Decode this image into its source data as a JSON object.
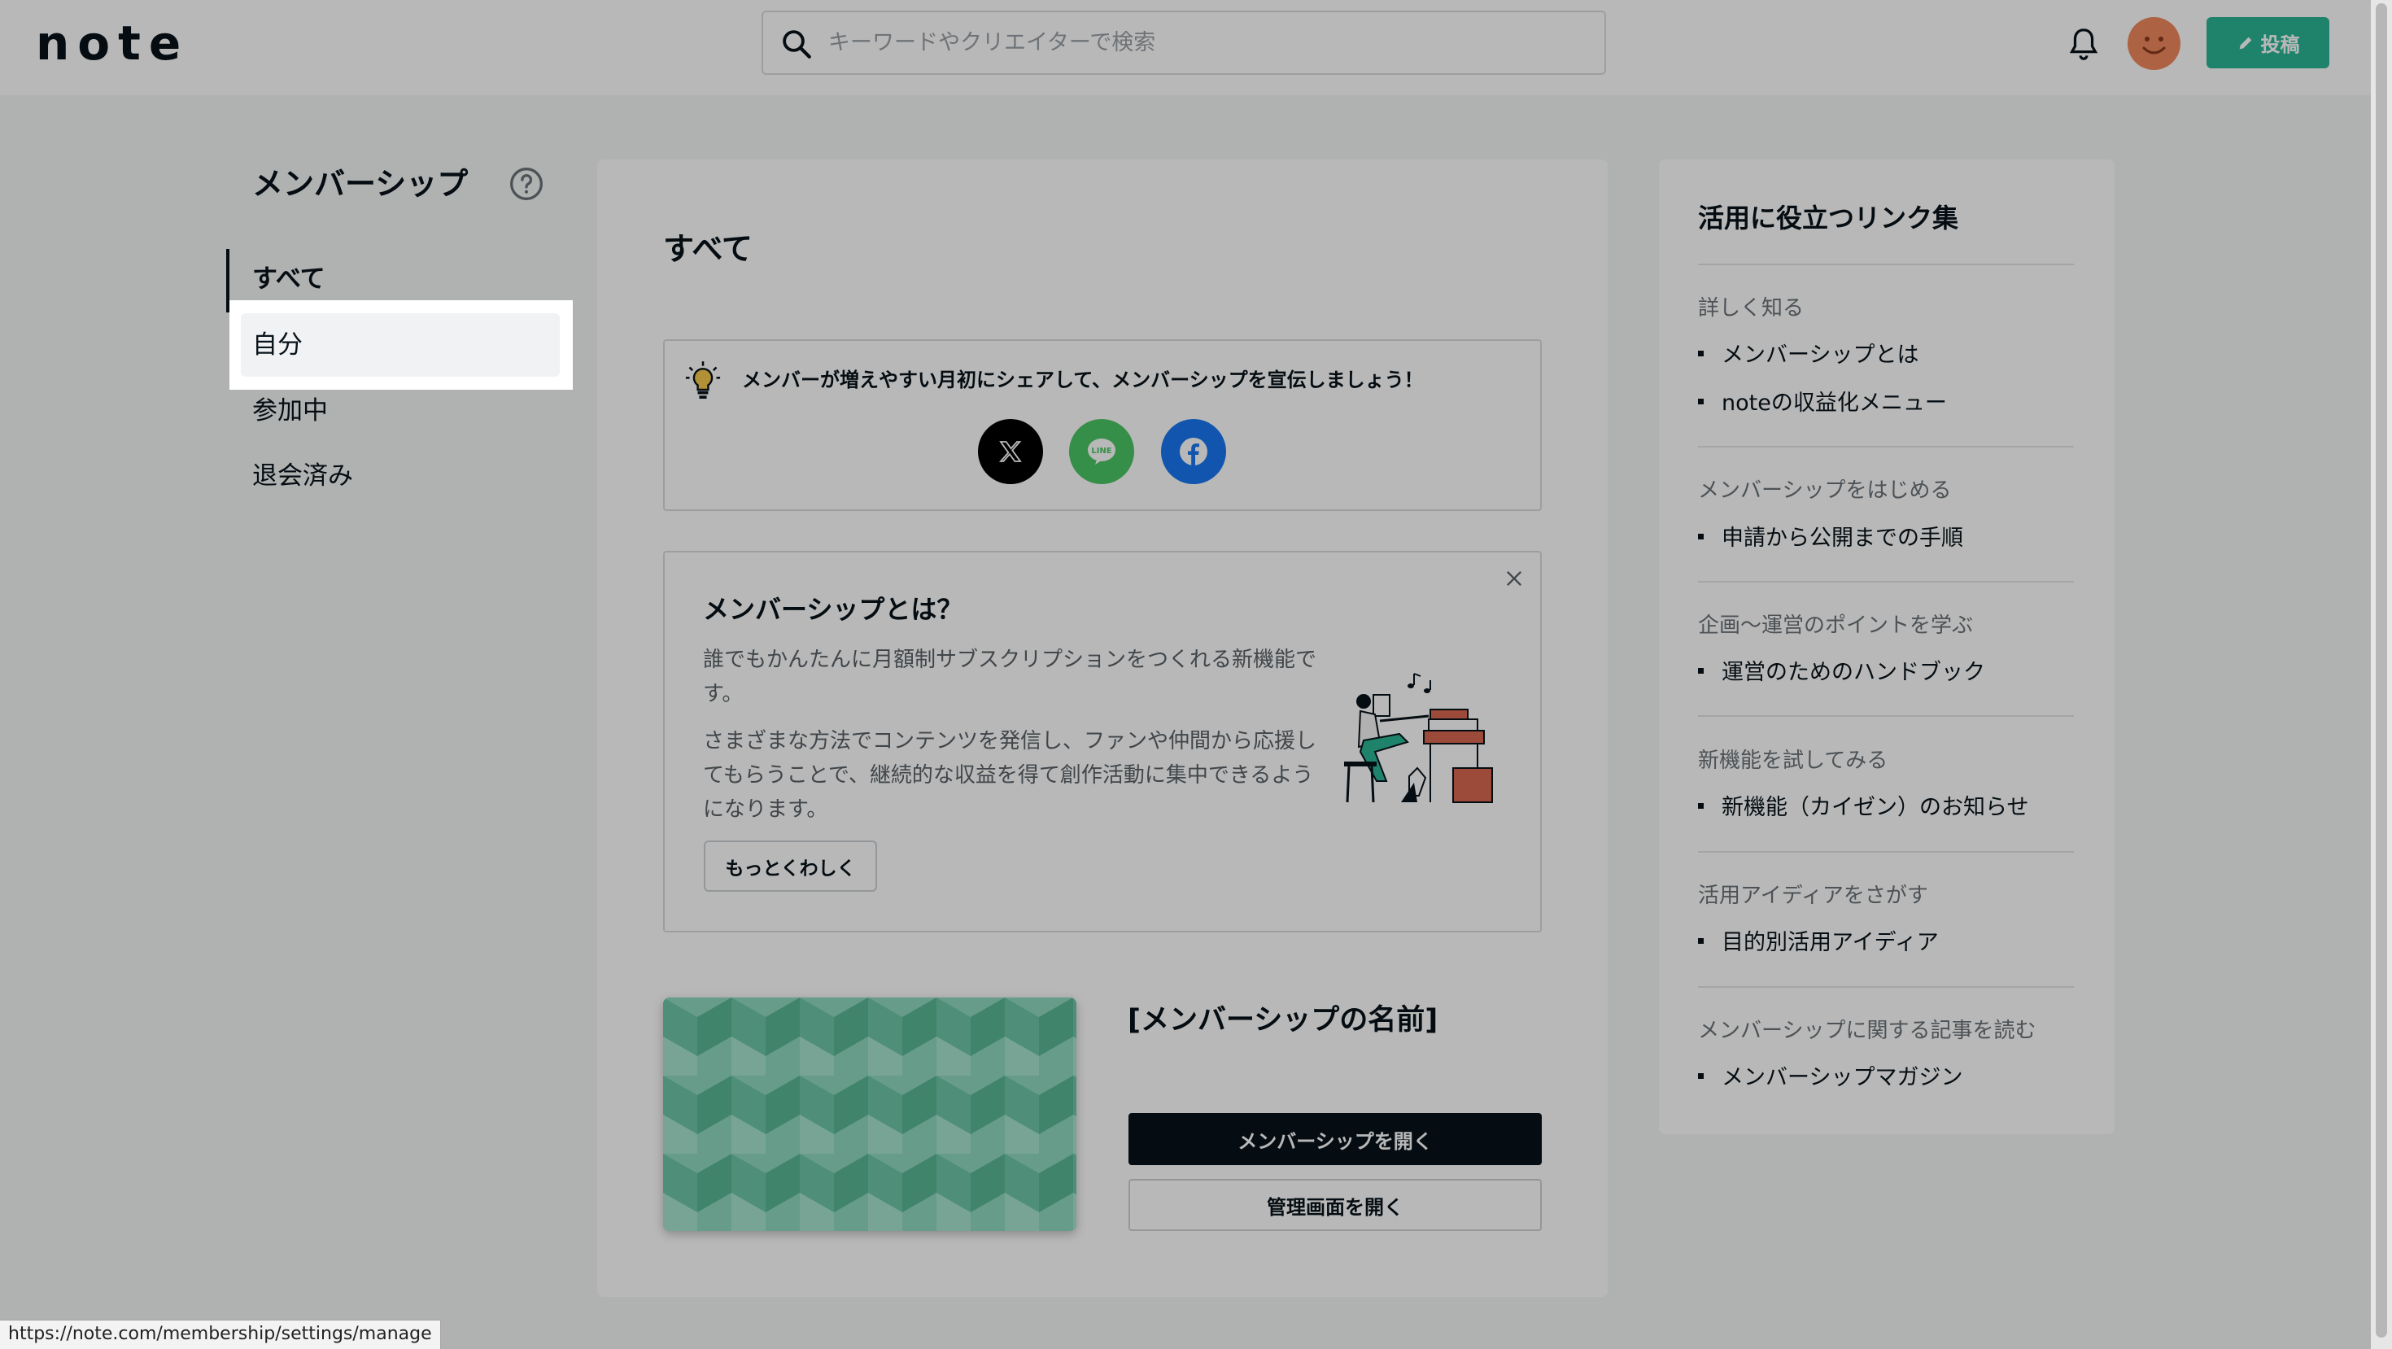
{
  "header": {
    "logo": "note",
    "search_placeholder": "キーワードやクリエイターで検索",
    "post_label": "投稿"
  },
  "sidebar": {
    "title": "メンバーシップ",
    "items": [
      {
        "label": "すべて"
      },
      {
        "label": "自分"
      },
      {
        "label": "参加中"
      },
      {
        "label": "退会済み"
      }
    ]
  },
  "main": {
    "title": "すべて",
    "share_text": "メンバーが増えやすい月初にシェアして、メンバーシップを宣伝しましょう！",
    "about": {
      "title": "メンバーシップとは？",
      "p1": "誰でもかんたんに月額制サブスクリプションをつくれる新機能です。",
      "p2": "さまざまな方法でコンテンツを発信し、ファンや仲間から応援してもらうことで、継続的な収益を得て創作活動に集中できるようになります。",
      "more_label": "もっとくわしく"
    },
    "membership_name": "[メンバーシップの名前]",
    "open_label": "メンバーシップを開く",
    "admin_label": "管理画面を開く"
  },
  "links": {
    "title": "活用に役立つリンク集",
    "sections": [
      {
        "heading": "詳しく知る",
        "items": [
          "メンバーシップとは",
          "noteの収益化メニュー"
        ]
      },
      {
        "heading": "メンバーシップをはじめる",
        "items": [
          "申請から公開までの手順"
        ]
      },
      {
        "heading": "企画〜運営のポイントを学ぶ",
        "items": [
          "運営のためのハンドブック"
        ]
      },
      {
        "heading": "新機能を試してみる",
        "items": [
          "新機能（カイゼン）のお知らせ"
        ]
      },
      {
        "heading": "活用アイディアをさがす",
        "items": [
          "目的別活用アイディア"
        ]
      },
      {
        "heading": "メンバーシップに関する記事を読む",
        "items": [
          "メンバーシップマガジン"
        ]
      }
    ]
  },
  "status_url": "https://note.com/membership/settings/manage",
  "colors": {
    "accent": "#2cb696",
    "x": "#000000",
    "line": "#4cc764",
    "facebook": "#1877f2"
  }
}
